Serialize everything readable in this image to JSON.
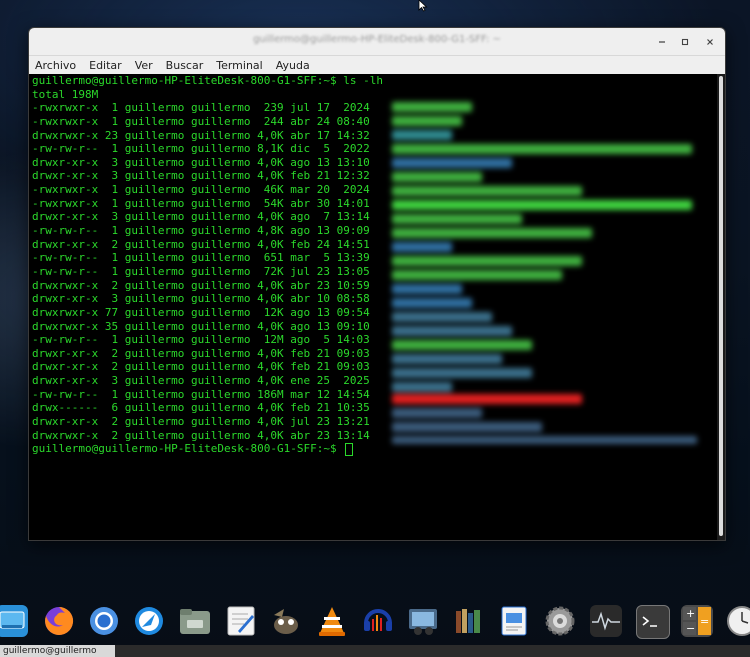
{
  "window": {
    "title": "guillermo@guillermo-HP-EliteDesk-800-G1-SFF: ~",
    "menu": [
      "Archivo",
      "Editar",
      "Ver",
      "Buscar",
      "Terminal",
      "Ayuda"
    ]
  },
  "terminal": {
    "lines": [
      "guillermo@guillermo-HP-EliteDesk-800-G1-SFF:~$ ls -lh",
      "total 198M",
      "-rwxrwxr-x  1 guillermo guillermo  239 jul 17  2024",
      "-rwxrwxr-x  1 guillermo guillermo  244 abr 24 08:40",
      "drwxrwxr-x 23 guillermo guillermo 4,0K abr 17 14:32",
      "-rw-rw-r--  1 guillermo guillermo 8,1K dic  5  2022",
      "drwxr-xr-x  3 guillermo guillermo 4,0K ago 13 13:10",
      "drwxr-xr-x  3 guillermo guillermo 4,0K feb 21 12:32",
      "-rwxrwxr-x  1 guillermo guillermo  46K mar 20  2024",
      "-rwxrwxr-x  1 guillermo guillermo  54K abr 30 14:01",
      "drwxr-xr-x  3 guillermo guillermo 4,0K ago  7 13:14",
      "-rw-rw-r--  1 guillermo guillermo 4,8K ago 13 09:09",
      "drwxr-xr-x  2 guillermo guillermo 4,0K feb 24 14:51",
      "-rw-rw-r--  1 guillermo guillermo  651 mar  5 13:39",
      "-rw-rw-r--  1 guillermo guillermo  72K jul 23 13:05",
      "drwxrwxr-x  2 guillermo guillermo 4,0K abr 23 10:59",
      "drwxr-xr-x  3 guillermo guillermo 4,0K abr 10 08:58",
      "drwxrwxr-x 77 guillermo guillermo  12K ago 13 09:54",
      "drwxrwxr-x 35 guillermo guillermo 4,0K ago 13 09:10",
      "-rw-rw-r--  1 guillermo guillermo  12M ago  5 14:03",
      "drwxr-xr-x  2 guillermo guillermo 4,0K feb 21 09:03",
      "drwxr-xr-x  2 guillermo guillermo 4,0K feb 21 09:03",
      "drwxr-xr-x  3 guillermo guillermo 4,0K ene 25  2025",
      "-rw-rw-r--  1 guillermo guillermo 186M mar 12 14:54",
      "drwx------  6 guillermo guillermo 4,0K feb 21 10:35",
      "drwxr-xr-x  2 guillermo guillermo 4,0K jul 23 13:21",
      "drwxrwxr-x  2 guillermo guillermo 4,0K abr 23 13:14"
    ],
    "prompt": "guillermo@guillermo-HP-EliteDesk-800-G1-SFF:~$ "
  },
  "colors": {
    "terminal_text": "#2bd82b",
    "terminal_bg": "#000000",
    "redacted_green": "#3fd23f",
    "redacted_red": "#e02020"
  },
  "dock": {
    "icons": [
      "show-desktop-icon",
      "firefox-icon",
      "chromium-icon",
      "thunderbird-icon",
      "files-icon",
      "text-editor-icon",
      "gimp-icon",
      "vlc-icon",
      "audacity-icon",
      "kdenlive-icon",
      "library-icon",
      "document-viewer-icon",
      "settings-icon",
      "system-monitor-icon",
      "terminal-icon",
      "calculator-icon",
      "clock-icon"
    ]
  },
  "taskbar": {
    "active_task": "guillermo@guillermo"
  }
}
